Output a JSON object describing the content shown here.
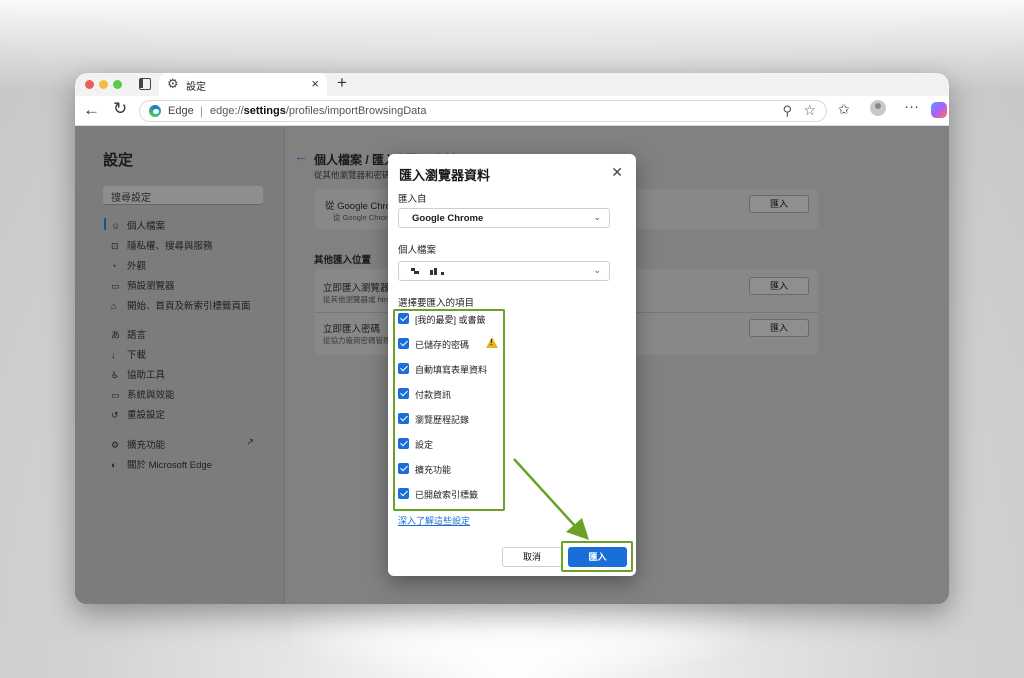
{
  "browser": {
    "tab_title": "設定",
    "address_brand": "Edge",
    "url_scheme": "edge://",
    "url_bold": "settings",
    "url_rest": "/profiles/importBrowsingData"
  },
  "settings_sidebar": {
    "title": "設定",
    "search_placeholder": "搜尋設定",
    "items": [
      {
        "label": "個人檔案",
        "icon": "profile-icon"
      },
      {
        "label": "隱私權、搜尋與服務",
        "icon": "lock-icon"
      },
      {
        "label": "外觀",
        "icon": "palette-icon"
      },
      {
        "label": "預設瀏覽器",
        "icon": "browser-icon"
      },
      {
        "label": "開始、首頁及新索引標籤頁面",
        "icon": "home-icon"
      },
      {
        "label": "語言",
        "icon": "language-icon"
      },
      {
        "label": "下載",
        "icon": "download-icon"
      },
      {
        "label": "協助工具",
        "icon": "accessibility-icon"
      },
      {
        "label": "系統與效能",
        "icon": "system-icon"
      },
      {
        "label": "重設設定",
        "icon": "reset-icon"
      },
      {
        "label": "擴充功能",
        "icon": "extensions-icon"
      },
      {
        "label": "關於 Microsoft Edge",
        "icon": "edge-icon"
      }
    ]
  },
  "main": {
    "heading": "個人檔案 / 匯入瀏覽器資料",
    "subheading": "從其他瀏覽器和密碼管理員匯入資料",
    "card1": {
      "title": "從 Google Chrome 匯入資料",
      "sub": "從 Google Chrome 匯入",
      "button": "匯入"
    },
    "section_label": "其他匯入位置",
    "card2_rows": [
      {
        "title": "立即匯入瀏覽器資料",
        "sub": "從其他瀏覽器或 html 檔案匯入",
        "button": "匯入"
      },
      {
        "title": "立即匯入密碼",
        "sub": "從協力廠商密碼管理員匯入",
        "button": "匯入"
      }
    ]
  },
  "dialog": {
    "title": "匯入瀏覽器資料",
    "import_from_label": "匯入自",
    "import_from_value": "Google Chrome",
    "profile_label": "個人檔案",
    "choose_label": "選擇要匯入的項目",
    "items": [
      {
        "label": "[我的最愛] 或書籤",
        "checked": true
      },
      {
        "label": "已儲存的密碼",
        "checked": true,
        "warning": true
      },
      {
        "label": "自動填寫表單資料",
        "checked": true
      },
      {
        "label": "付款資訊",
        "checked": true
      },
      {
        "label": "瀏覽歷程記錄",
        "checked": true
      },
      {
        "label": "設定",
        "checked": true
      },
      {
        "label": "擴充功能",
        "checked": true
      },
      {
        "label": "已開啟索引標籤",
        "checked": true
      }
    ],
    "learn_more": "深入了解這些設定",
    "cancel": "取消",
    "import": "匯入"
  },
  "colors": {
    "highlight_green": "#6aa227",
    "accent_blue": "#1a6ed8"
  }
}
